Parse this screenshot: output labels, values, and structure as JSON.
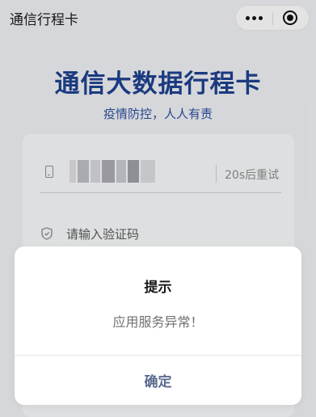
{
  "nav": {
    "title": "通信行程卡",
    "more_icon": "more-dots-icon",
    "close_icon": "close-circle-icon"
  },
  "page": {
    "headline": "通信大数据行程卡",
    "subline": "疫情防控，人人有责"
  },
  "form": {
    "phone_icon": "phone-icon",
    "phone_number_masked": true,
    "resend_label": "20s后重试",
    "code_icon": "shield-icon",
    "code_placeholder": "请输入验证码"
  },
  "dialog": {
    "title": "提示",
    "message": "应用服务异常！",
    "confirm_label": "确定"
  },
  "colors": {
    "brand_blue": "#1e3f8a",
    "confirm_text": "#5b6b8f",
    "page_background": "#e9eaed"
  }
}
